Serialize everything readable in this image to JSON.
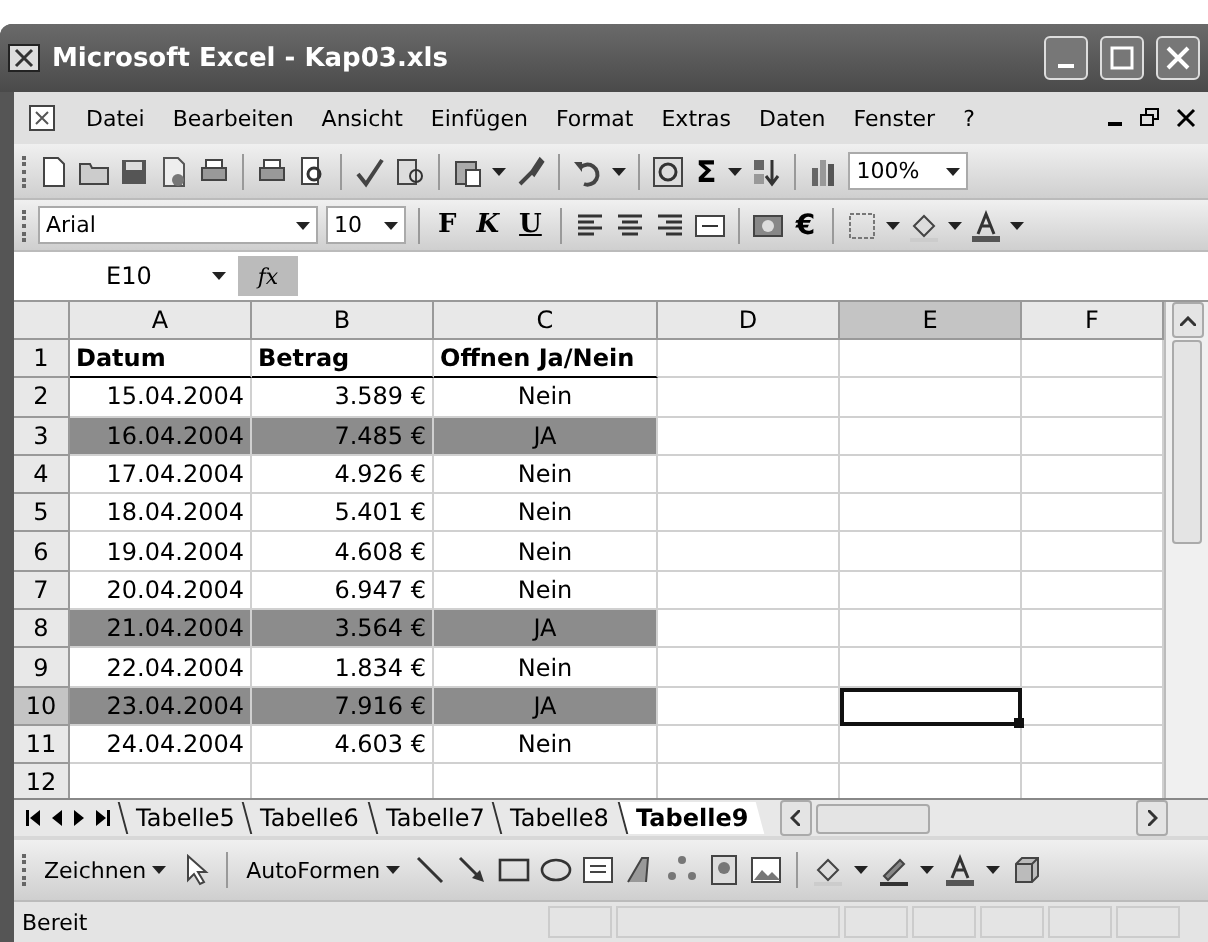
{
  "window": {
    "title": "Microsoft Excel - Kap03.xls"
  },
  "menu": [
    "Datei",
    "Bearbeiten",
    "Ansicht",
    "Einfügen",
    "Format",
    "Extras",
    "Daten",
    "Fenster",
    "?"
  ],
  "standard_toolbar": {
    "sum": "Σ",
    "zoom": "100%"
  },
  "format_toolbar": {
    "font": "Arial",
    "size": "10",
    "bold": "F",
    "italic": "K",
    "underline": "U",
    "euro": "€"
  },
  "formula_bar": {
    "name_box": "E10",
    "fx": "fx"
  },
  "columns": [
    {
      "label": "A",
      "selected": false
    },
    {
      "label": "B",
      "selected": false
    },
    {
      "label": "C",
      "selected": false
    },
    {
      "label": "D",
      "selected": false
    },
    {
      "label": "E",
      "selected": true
    },
    {
      "label": "F",
      "selected": false
    }
  ],
  "rows": [
    {
      "number": "1",
      "selected": false,
      "highlighted": false,
      "kind": "header",
      "cells": [
        "Datum",
        "Betrag",
        "Offnen Ja/Nein"
      ]
    },
    {
      "number": "2",
      "selected": false,
      "highlighted": false,
      "kind": "data",
      "cells": [
        "15.04.2004",
        "3.589 €",
        "Nein"
      ]
    },
    {
      "number": "3",
      "selected": false,
      "highlighted": true,
      "kind": "data",
      "cells": [
        "16.04.2004",
        "7.485 €",
        "JA"
      ]
    },
    {
      "number": "4",
      "selected": false,
      "highlighted": false,
      "kind": "data",
      "cells": [
        "17.04.2004",
        "4.926 €",
        "Nein"
      ]
    },
    {
      "number": "5",
      "selected": false,
      "highlighted": false,
      "kind": "data",
      "cells": [
        "18.04.2004",
        "5.401 €",
        "Nein"
      ]
    },
    {
      "number": "6",
      "selected": false,
      "highlighted": false,
      "kind": "data",
      "cells": [
        "19.04.2004",
        "4.608 €",
        "Nein"
      ]
    },
    {
      "number": "7",
      "selected": false,
      "highlighted": false,
      "kind": "data",
      "cells": [
        "20.04.2004",
        "6.947 €",
        "Nein"
      ]
    },
    {
      "number": "8",
      "selected": false,
      "highlighted": true,
      "kind": "data",
      "cells": [
        "21.04.2004",
        "3.564 €",
        "JA"
      ]
    },
    {
      "number": "9",
      "selected": false,
      "highlighted": false,
      "kind": "data",
      "cells": [
        "22.04.2004",
        "1.834 €",
        "Nein"
      ]
    },
    {
      "number": "10",
      "selected": true,
      "highlighted": true,
      "kind": "data",
      "cells": [
        "23.04.2004",
        "7.916 €",
        "JA"
      ]
    },
    {
      "number": "11",
      "selected": false,
      "highlighted": false,
      "kind": "data",
      "cells": [
        "24.04.2004",
        "4.603 €",
        "Nein"
      ]
    },
    {
      "number": "12",
      "selected": false,
      "highlighted": false,
      "kind": "data",
      "cells": []
    }
  ],
  "sheet_tabs": [
    {
      "label": "Tabelle5",
      "selected": false
    },
    {
      "label": "Tabelle6",
      "selected": false
    },
    {
      "label": "Tabelle7",
      "selected": false
    },
    {
      "label": "Tabelle8",
      "selected": false
    },
    {
      "label": "Tabelle9",
      "selected": true
    }
  ],
  "drawing_toolbar": {
    "draw": "Zeichnen",
    "autoshapes": "AutoFormen"
  },
  "status_bar": {
    "text": "Bereit"
  }
}
